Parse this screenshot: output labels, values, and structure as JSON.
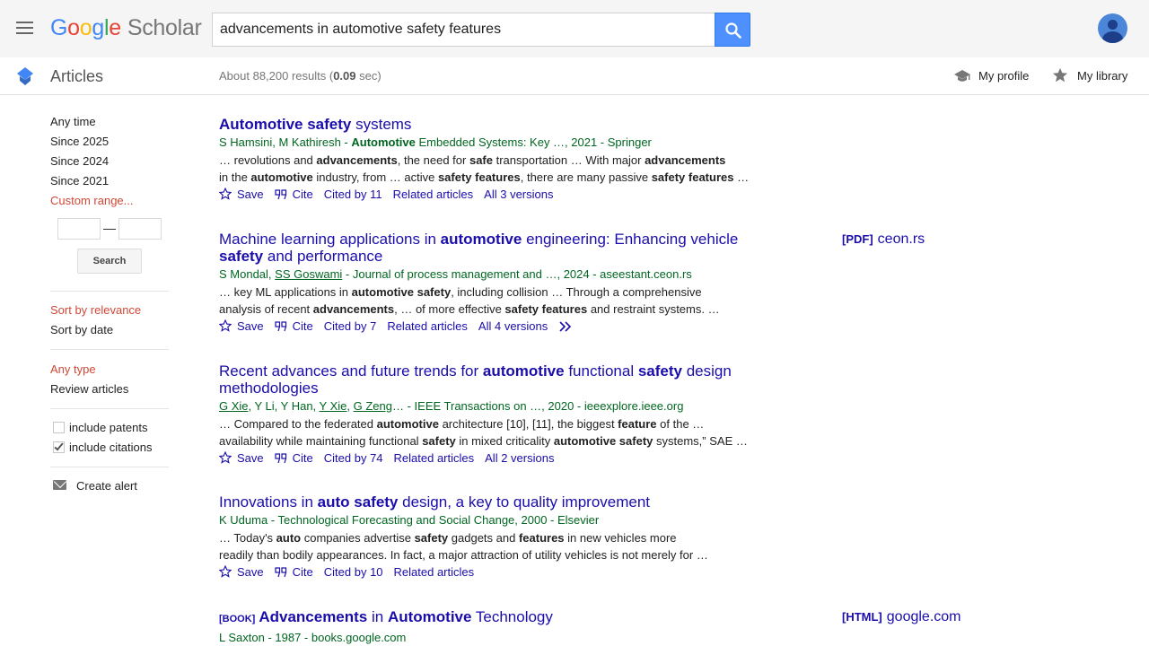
{
  "header": {
    "logo_google": "Google",
    "logo_scholar": "Scholar",
    "search_value": "advancements in automotive safety features"
  },
  "subbar": {
    "section": "Articles",
    "results_prefix": "About 88,200 results (",
    "results_time": "0.09",
    "results_suffix": " sec)",
    "my_profile": "My profile",
    "my_library": "My library"
  },
  "sidebar": {
    "time": [
      "Any time",
      "Since 2025",
      "Since 2024",
      "Since 2021",
      "Custom range..."
    ],
    "search_button": "Search",
    "range_dash": "—",
    "sort": [
      "Sort by relevance",
      "Sort by date"
    ],
    "type": [
      "Any type",
      "Review articles"
    ],
    "include_patents": "include patents",
    "include_citations": "include citations",
    "create_alert": "Create alert"
  },
  "results": [
    {
      "tag": "",
      "title_parts": [
        [
          "b",
          "Automotive safety"
        ],
        [
          "t",
          " systems"
        ]
      ],
      "meta_parts": [
        [
          "t",
          "S Hamsini, M Kathiresh - "
        ],
        [
          "b",
          "Automotive"
        ],
        [
          "t",
          " Embedded Systems: Key …, 2021 - Springer"
        ]
      ],
      "snippet_lines": [
        [
          [
            "t",
            "… revolutions and "
          ],
          [
            "b",
            "advancements"
          ],
          [
            "t",
            ", the need for "
          ],
          [
            "b",
            "safe"
          ],
          [
            "t",
            " transportation … With major "
          ],
          [
            "b",
            "advancements"
          ]
        ],
        [
          [
            "t",
            "in the "
          ],
          [
            "b",
            "automotive"
          ],
          [
            "t",
            " industry, from … active "
          ],
          [
            "b",
            "safety features"
          ],
          [
            "t",
            ", there are many passive "
          ],
          [
            "b",
            "safety features"
          ],
          [
            "t",
            " …"
          ]
        ]
      ],
      "actions": {
        "save": "Save",
        "cite": "Cite",
        "cited_by": "Cited by 11",
        "related": "Related articles",
        "versions": "All 3 versions"
      },
      "side": null
    },
    {
      "tag": "",
      "title_parts": [
        [
          "t",
          "Machine learning applications in "
        ],
        [
          "b",
          "automotive"
        ],
        [
          "t",
          " engineering: Enhancing vehicle "
        ],
        [
          "br",
          ""
        ],
        [
          "b",
          "safety"
        ],
        [
          "t",
          " and performance"
        ]
      ],
      "meta_parts": [
        [
          "t",
          "S Mondal, "
        ],
        [
          "u",
          "SS Goswami"
        ],
        [
          "t",
          " - Journal of process management and …, 2024 - aseestant.ceon.rs"
        ]
      ],
      "snippet_lines": [
        [
          [
            "t",
            "… key ML applications in "
          ],
          [
            "b",
            "automotive safety"
          ],
          [
            "t",
            ", including collision … Through a comprehensive"
          ]
        ],
        [
          [
            "t",
            "analysis of recent "
          ],
          [
            "b",
            "advancements"
          ],
          [
            "t",
            ", … of more effective "
          ],
          [
            "b",
            "safety features"
          ],
          [
            "t",
            " and restraint systems. …"
          ]
        ]
      ],
      "actions": {
        "save": "Save",
        "cite": "Cite",
        "cited_by": "Cited by 7",
        "related": "Related articles",
        "versions": "All 4 versions"
      },
      "side": {
        "tag": "[PDF]",
        "text": "ceon.rs"
      }
    },
    {
      "tag": "",
      "title_parts": [
        [
          "t",
          "Recent advances and future trends for "
        ],
        [
          "b",
          "automotive"
        ],
        [
          "t",
          " functional "
        ],
        [
          "b",
          "safety"
        ],
        [
          "t",
          " design "
        ],
        [
          "br",
          ""
        ],
        [
          "t",
          "methodologies"
        ]
      ],
      "meta_parts": [
        [
          "u",
          "G Xie"
        ],
        [
          "t",
          ", Y Li, Y Han, "
        ],
        [
          "u",
          "Y Xie"
        ],
        [
          "t",
          ", "
        ],
        [
          "u",
          "G Zeng"
        ],
        [
          "t",
          "… - IEEE Transactions on …, 2020 - ieeexplore.ieee.org"
        ]
      ],
      "snippet_lines": [
        [
          [
            "t",
            "… Compared to the federated "
          ],
          [
            "b",
            "automotive"
          ],
          [
            "t",
            " architecture [10], [11], the biggest "
          ],
          [
            "b",
            "feature"
          ],
          [
            "t",
            " of the …"
          ]
        ],
        [
          [
            "t",
            "availability while maintaining functional "
          ],
          [
            "b",
            "safety"
          ],
          [
            "t",
            " in mixed criticality "
          ],
          [
            "b",
            "automotive safety"
          ],
          [
            "t",
            " systems,” SAE …"
          ]
        ]
      ],
      "actions": {
        "save": "Save",
        "cite": "Cite",
        "cited_by": "Cited by 74",
        "related": "Related articles",
        "versions": "All 2 versions"
      },
      "side": null
    },
    {
      "tag": "",
      "title_parts": [
        [
          "t",
          "Innovations in "
        ],
        [
          "b",
          "auto safety"
        ],
        [
          "t",
          " design, a key to quality improvement"
        ]
      ],
      "meta_parts": [
        [
          "t",
          "K Uduma - Technological Forecasting and Social Change, 2000 - Elsevier"
        ]
      ],
      "snippet_lines": [
        [
          [
            "t",
            "… Today's "
          ],
          [
            "b",
            "auto"
          ],
          [
            "t",
            " companies advertise "
          ],
          [
            "b",
            "safety"
          ],
          [
            "t",
            " gadgets and "
          ],
          [
            "b",
            "features"
          ],
          [
            "t",
            " in new vehicles more"
          ]
        ],
        [
          [
            "t",
            "readily than bodily appearances. In fact, a major attraction of utility vehicles is not merely for …"
          ]
        ]
      ],
      "actions": {
        "save": "Save",
        "cite": "Cite",
        "cited_by": "Cited by 10",
        "related": "Related articles",
        "versions": ""
      },
      "side": null
    },
    {
      "tag": "[BOOK]",
      "title_parts": [
        [
          "b",
          "Advancements"
        ],
        [
          "t",
          " in "
        ],
        [
          "b",
          "Automotive"
        ],
        [
          "t",
          " Technology"
        ]
      ],
      "meta_parts": [
        [
          "t",
          "L Saxton - 1987 - books.google.com"
        ]
      ],
      "snippet_lines": [],
      "actions": null,
      "side": {
        "tag": "[HTML]",
        "text": "google.com"
      }
    }
  ]
}
